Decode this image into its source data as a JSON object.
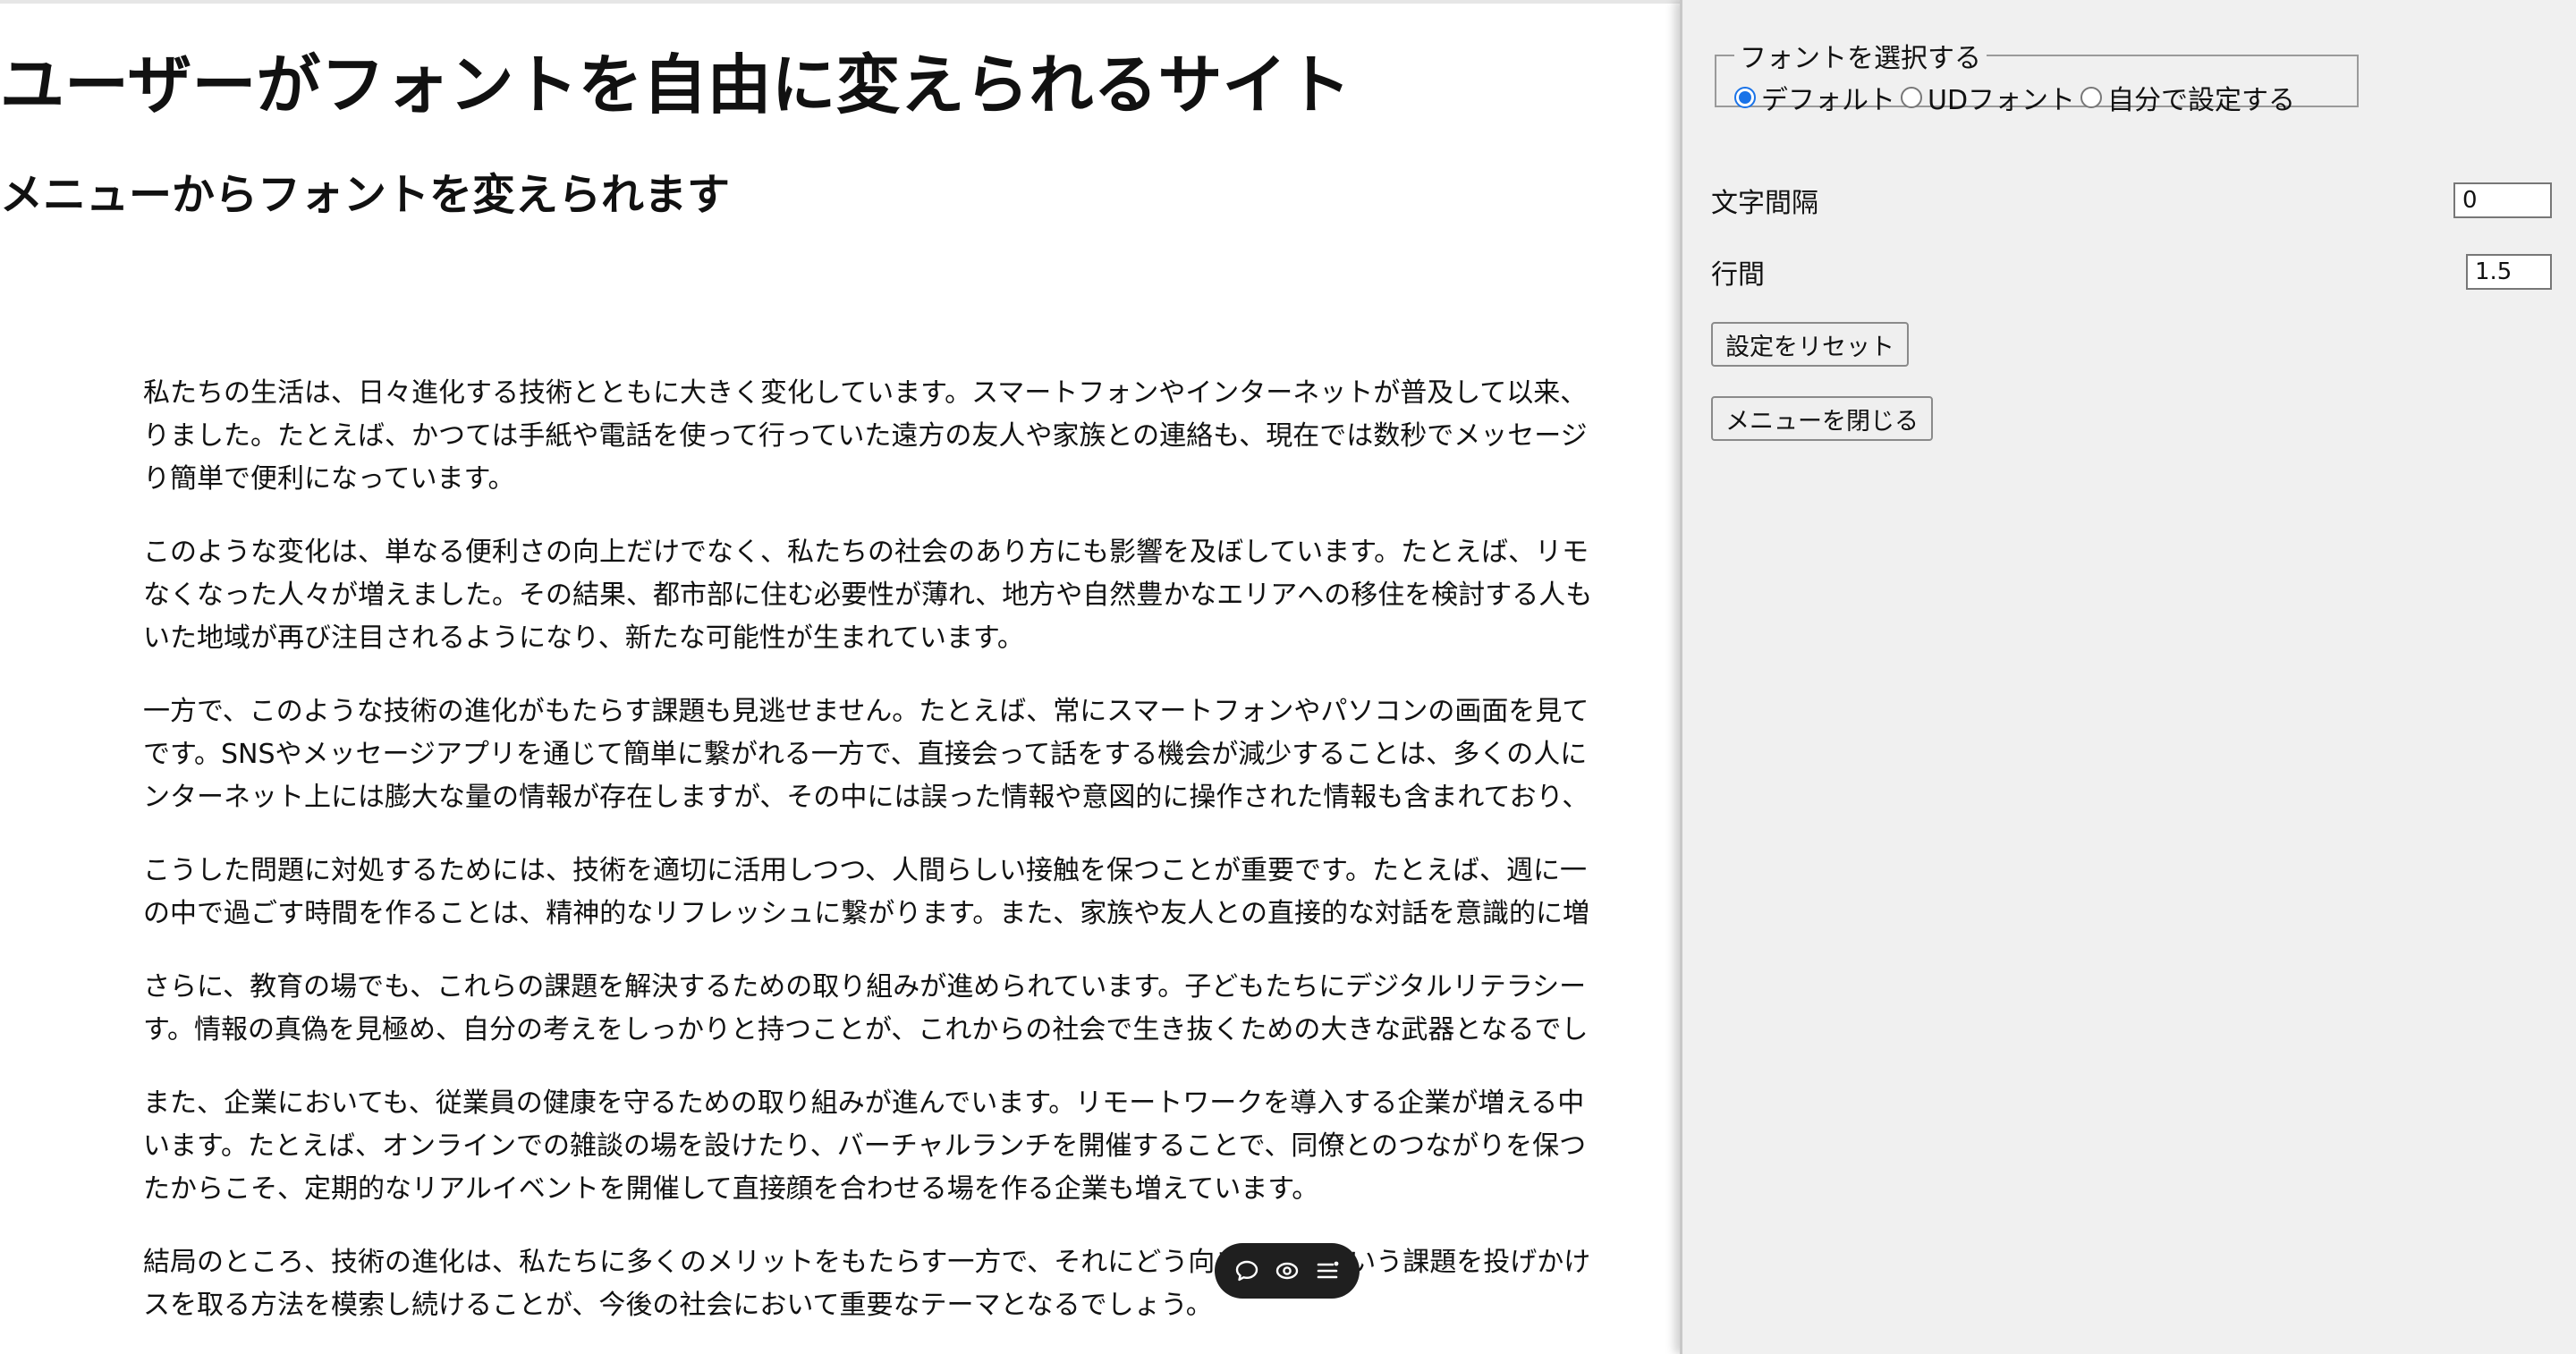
{
  "main": {
    "title": "ユーザーがフォントを自由に変えられるサイト",
    "subtitle": "メニューからフォントを変えられます",
    "paragraphs": [
      [
        "私たちの生活は、日々進化する技術とともに大きく変化しています。スマートフォンやインターネットが普及して以来、",
        "りました。たとえば、かつては手紙や電話を使って行っていた遠方の友人や家族との連絡も、現在では数秒でメッセージ",
        "り簡単で便利になっています。"
      ],
      [
        "このような変化は、単なる便利さの向上だけでなく、私たちの社会のあり方にも影響を及ぼしています。たとえば、リモ",
        "なくなった人々が増えました。その結果、都市部に住む必要性が薄れ、地方や自然豊かなエリアへの移住を検討する人も",
        "いた地域が再び注目されるようになり、新たな可能性が生まれています。"
      ],
      [
        "一方で、このような技術の進化がもたらす課題も見逃せません。たとえば、常にスマートフォンやパソコンの画面を見て",
        "です。SNSやメッセージアプリを通じて簡単に繋がれる一方で、直接会って話をする機会が減少することは、多くの人に",
        "ンターネット上には膨大な量の情報が存在しますが、その中には誤った情報や意図的に操作された情報も含まれており、"
      ],
      [
        "こうした問題に対処するためには、技術を適切に活用しつつ、人間らしい接触を保つことが重要です。たとえば、週に一",
        "の中で過ごす時間を作ることは、精神的なリフレッシュに繋がります。また、家族や友人との直接的な対話を意識的に増"
      ],
      [
        "さらに、教育の場でも、これらの課題を解決するための取り組みが進められています。子どもたちにデジタルリテラシー",
        "す。情報の真偽を見極め、自分の考えをしっかりと持つことが、これからの社会で生き抜くための大きな武器となるでし"
      ],
      [
        "また、企業においても、従業員の健康を守るための取り組みが進んでいます。リモートワークを導入する企業が増える中",
        "います。たとえば、オンラインでの雑談の場を設けたり、バーチャルランチを開催することで、同僚とのつながりを保つ",
        "たからこそ、定期的なリアルイベントを開催して直接顔を合わせる場を作る企業も増えています。"
      ],
      [
        "結局のところ、技術の進化は、私たちに多くのメリットをもたらす一方で、それにどう向き合うかという課題を投げかけ",
        "スを取る方法を模索し続けることが、今後の社会において重要なテーマとなるでしょう。"
      ]
    ]
  },
  "panel": {
    "font_legend": "フォントを選択する",
    "font_options": [
      {
        "label": "デフォルト",
        "checked": true
      },
      {
        "label": "UDフォント",
        "checked": false
      },
      {
        "label": "自分で設定する",
        "checked": false
      }
    ],
    "letter_spacing_label": "文字間隔",
    "letter_spacing_value": "0",
    "line_height_label": "行間",
    "line_height_value": "1.5",
    "reset_button": "設定をリセット",
    "close_button": "メニューを閉じる"
  },
  "toolbar": {
    "icons": [
      "comment-icon",
      "eye-icon",
      "menu-list-icon"
    ]
  },
  "colors": {
    "panel_bg": "#f0f0f0",
    "radio_accent": "#1a73e8",
    "toolbar_bg": "#1f1f1f"
  }
}
